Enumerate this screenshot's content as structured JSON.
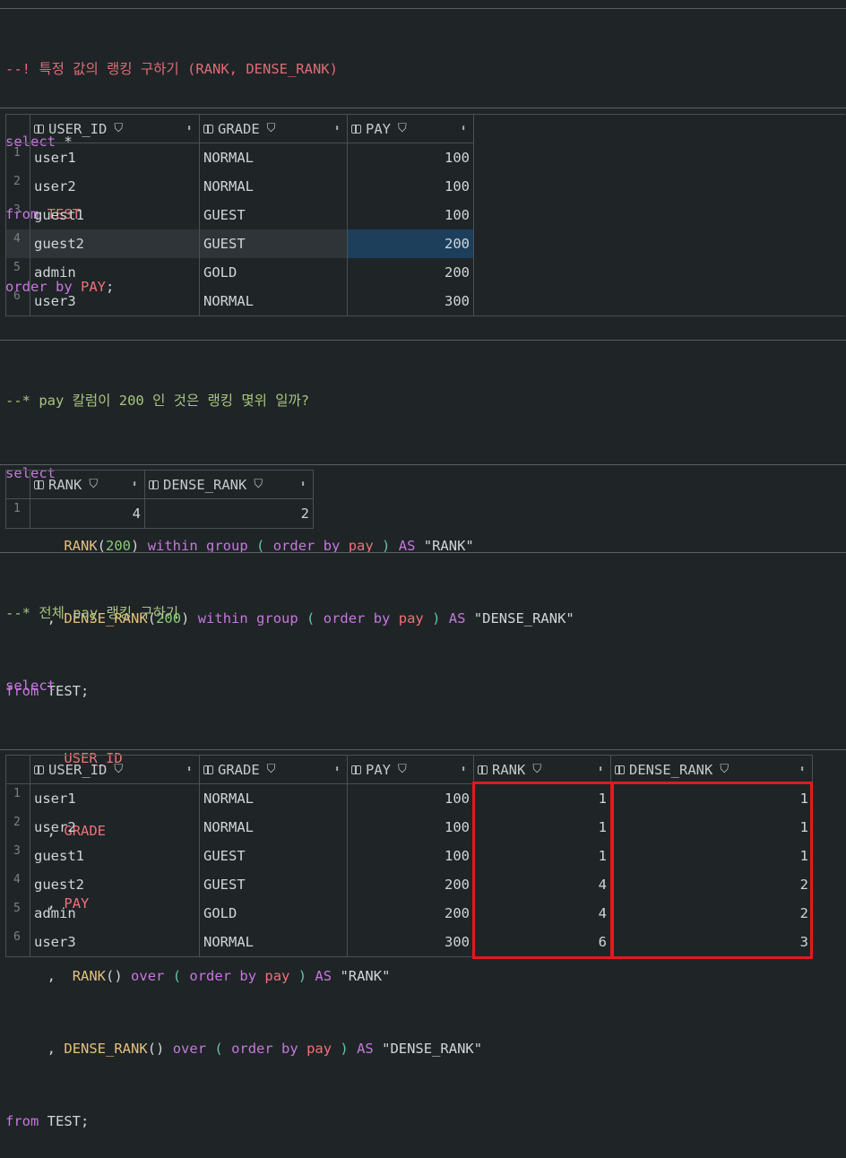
{
  "block1": {
    "code": [
      "--! 특정 값의 랭킹 구하기 (RANK, DENSE_RANK)",
      "select *",
      "from TEST",
      "order by PAY;"
    ],
    "columns": [
      "USER_ID",
      "GRADE",
      "PAY"
    ],
    "rows": [
      [
        "1",
        "user1",
        "NORMAL",
        "100"
      ],
      [
        "2",
        "user2",
        "NORMAL",
        "100"
      ],
      [
        "3",
        "guest1",
        "GUEST",
        "100"
      ],
      [
        "4",
        "guest2",
        "GUEST",
        "200"
      ],
      [
        "5",
        "admin",
        "GOLD",
        "200"
      ],
      [
        "6",
        "user3",
        "NORMAL",
        "300"
      ]
    ]
  },
  "block2": {
    "comment": "--* pay 칼럼이 200 인 것은 랭킹 몇위 일까?",
    "columns": [
      "RANK",
      "DENSE_RANK"
    ],
    "rows": [
      [
        "1",
        "4",
        "2"
      ]
    ]
  },
  "block3": {
    "comment": "--* 전체 pay 랭킹 구하기",
    "columns": [
      "USER_ID",
      "GRADE",
      "PAY",
      "RANK",
      "DENSE_RANK"
    ],
    "rows": [
      [
        "1",
        "user1",
        "NORMAL",
        "100",
        "1",
        "1"
      ],
      [
        "2",
        "user2",
        "NORMAL",
        "100",
        "1",
        "1"
      ],
      [
        "3",
        "guest1",
        "GUEST",
        "100",
        "1",
        "1"
      ],
      [
        "4",
        "guest2",
        "GUEST",
        "200",
        "4",
        "2"
      ],
      [
        "5",
        "admin",
        "GOLD",
        "200",
        "4",
        "2"
      ],
      [
        "6",
        "user3",
        "NORMAL",
        "300",
        "6",
        "3"
      ]
    ]
  },
  "icons": {
    "column": "column-icon",
    "filter": "filter-icon",
    "sort": "sort-icon"
  },
  "colors": {
    "background": "#1f2427",
    "keyword": "#c678dd",
    "comment": "#a9c47f",
    "highlight": "#e01b1b",
    "selection": "#1e3f5c"
  }
}
